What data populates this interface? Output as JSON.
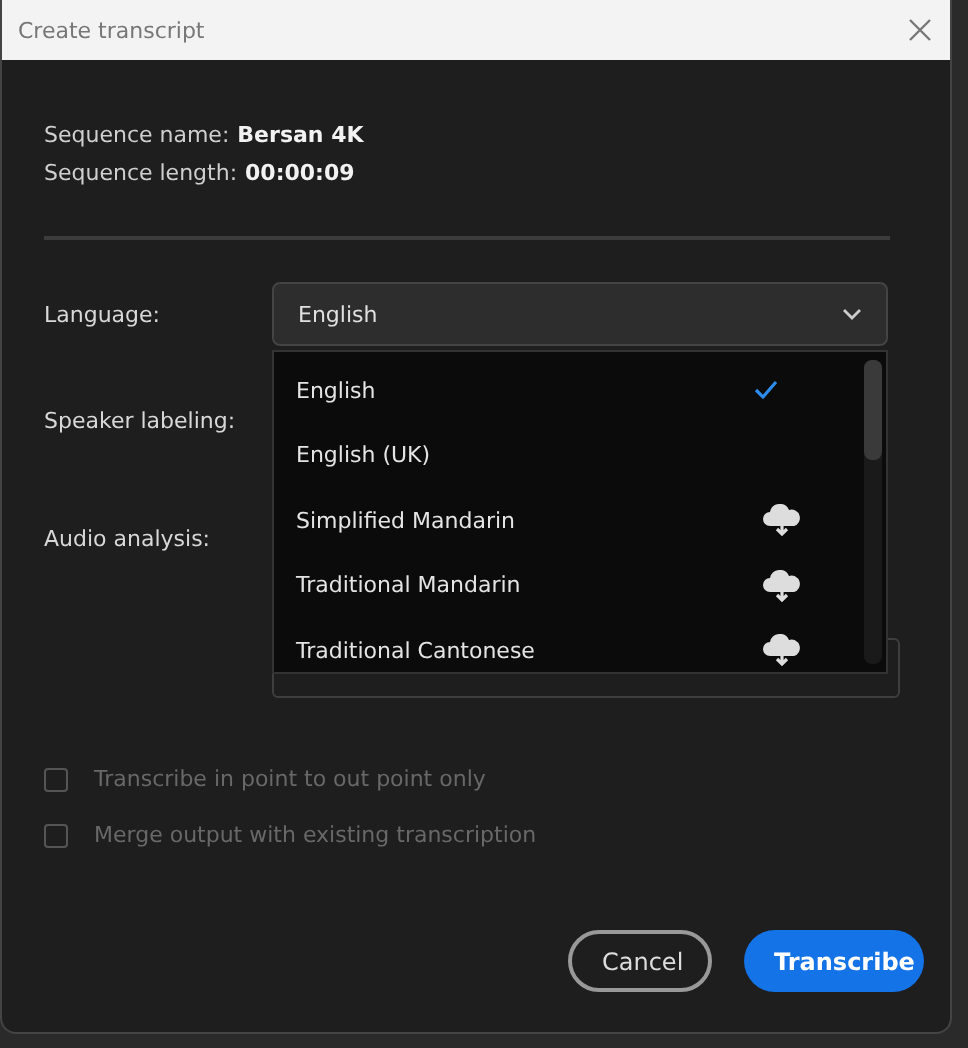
{
  "window": {
    "title": "Create transcript"
  },
  "sequence": [
    {
      "label": "Sequence name:",
      "value": "Bersan 4K"
    },
    {
      "label": "Sequence length:",
      "value": "00:00:09"
    }
  ],
  "language": {
    "label": "Language:",
    "value": "English",
    "expanded": true,
    "options": [
      {
        "label": "English",
        "selected": true,
        "downloadable": false
      },
      {
        "label": "English (UK)",
        "selected": false,
        "downloadable": false
      },
      {
        "label": "Simplified Mandarin",
        "selected": false,
        "downloadable": true
      },
      {
        "label": "Traditional Mandarin",
        "selected": false,
        "downloadable": true
      },
      {
        "label": "Traditional Cantonese",
        "selected": false,
        "downloadable": true
      }
    ]
  },
  "speaker_labeling": {
    "label": "Speaker labeling:"
  },
  "audio_analysis": {
    "label": "Audio analysis:"
  },
  "checkboxes": [
    {
      "label": "Transcribe in point to out point only",
      "checked": false,
      "disabled": true
    },
    {
      "label": "Merge output with existing transcription",
      "checked": false,
      "disabled": true
    }
  ],
  "buttons": [
    {
      "label": "Cancel",
      "kind": "secondary"
    },
    {
      "label": "Transcribe",
      "kind": "primary"
    }
  ]
}
